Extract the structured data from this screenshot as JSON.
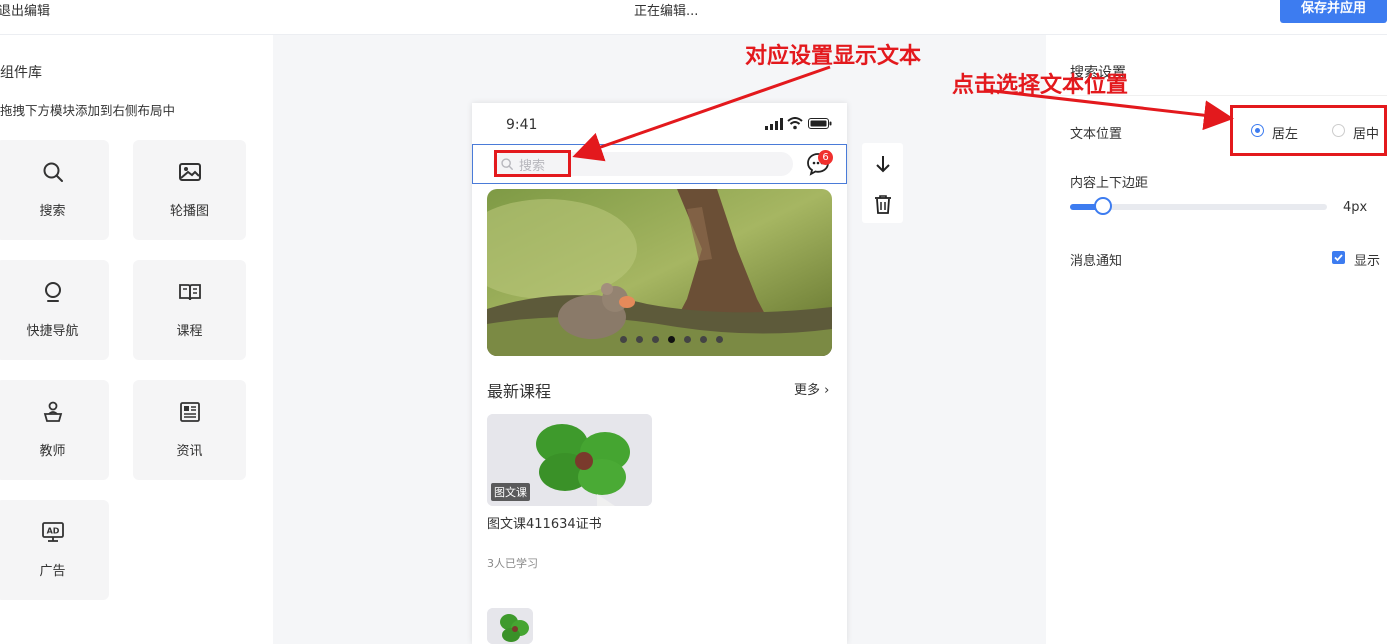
{
  "topbar": {
    "exit_label": "退出编辑",
    "status": "正在编辑...",
    "save_label": "保存并应用"
  },
  "library": {
    "title": "组件库",
    "hint": "拖拽下方模块添加到右侧布局中",
    "components": [
      {
        "label": "搜索",
        "icon": "search-icon"
      },
      {
        "label": "轮播图",
        "icon": "image-icon"
      },
      {
        "label": "快捷导航",
        "icon": "bulb-icon"
      },
      {
        "label": "课程",
        "icon": "book-icon"
      },
      {
        "label": "教师",
        "icon": "teacher-icon"
      },
      {
        "label": "资讯",
        "icon": "news-icon"
      },
      {
        "label": "广告",
        "icon": "ad-icon"
      }
    ]
  },
  "phone": {
    "time": "9:41",
    "search_placeholder": "搜索",
    "message_badge": "6",
    "banner_dots": 7,
    "banner_active_dot": 4,
    "section_title": "最新课程",
    "more_label": "更多",
    "course": {
      "tag": "图文课",
      "title": "图文课411634证书",
      "students": "3人已学习"
    }
  },
  "settings": {
    "title": "搜索设置",
    "text_position_label": "文本位置",
    "options": [
      "居左",
      "居中"
    ],
    "selected_option": "居左",
    "padding_label": "内容上下边距",
    "padding_value": "4px",
    "padding_fraction": 0.13,
    "message_label": "消息通知",
    "message_option": "显示",
    "message_checked": true
  },
  "annotations": {
    "left_note": "对应设置显示文本",
    "right_note": "点击选择文本位置"
  },
  "colors": {
    "accent": "#3d7cf0",
    "annotation": "#e3191d",
    "badge": "#f0302e"
  }
}
